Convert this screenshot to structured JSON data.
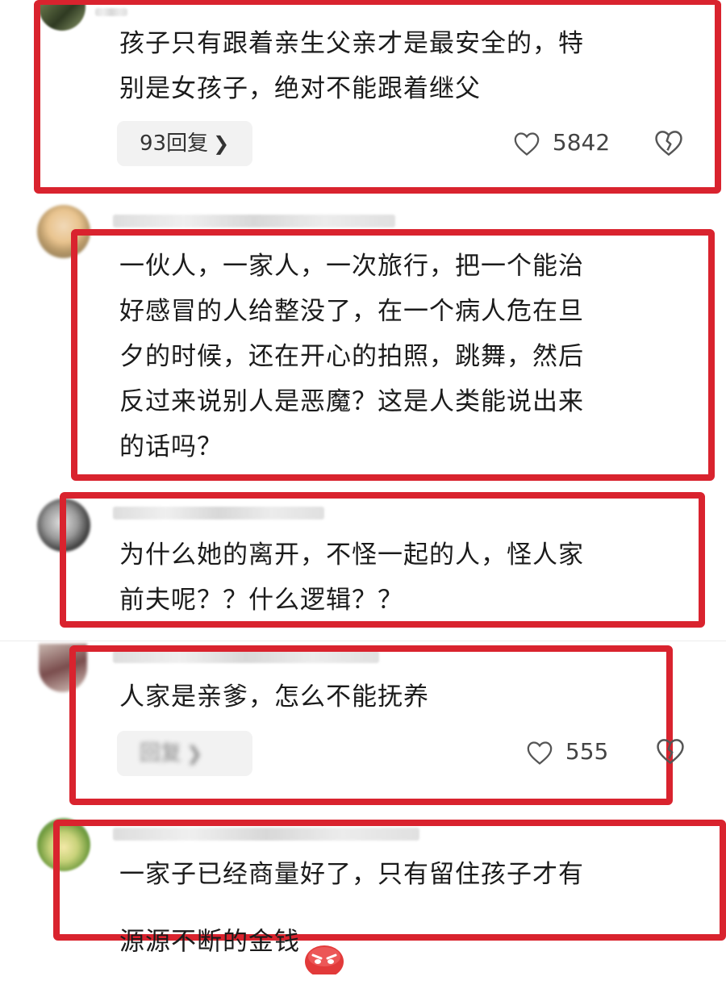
{
  "comments": [
    {
      "text": "孩子只有跟着亲生父亲才是最安全的，特\n别是女孩子，绝对不能跟着继父",
      "reply_label": "93回复",
      "likes": "5842"
    },
    {
      "text": "一伙人，一家人，一次旅行，把一个能治\n好感冒的人给整没了，在一个病人危在旦\n夕的时候，还在开心的拍照，跳舞，然后\n反过来说别人是恶魔？这是人类能说出来\n的话吗？"
    },
    {
      "text": "为什么她的离开，不怪一起的人，怪人家\n前夫呢？？什么逻辑？？"
    },
    {
      "text": "人家是亲爹，怎么不能抚养",
      "reply_label": "回复",
      "likes": "555"
    },
    {
      "text": "一家子已经商量好了，只有留住孩子才有\n源源不断的金钱"
    }
  ],
  "icons": {
    "like": "heart-outline-icon",
    "dislike": "broken-heart-icon",
    "chevron": "chevron-right-icon",
    "emoji": "angry-face-emoji"
  },
  "colors": {
    "highlight_frame": "#d9232e",
    "reply_pill_bg": "#f2f2f2",
    "text": "#1b1b1b"
  }
}
